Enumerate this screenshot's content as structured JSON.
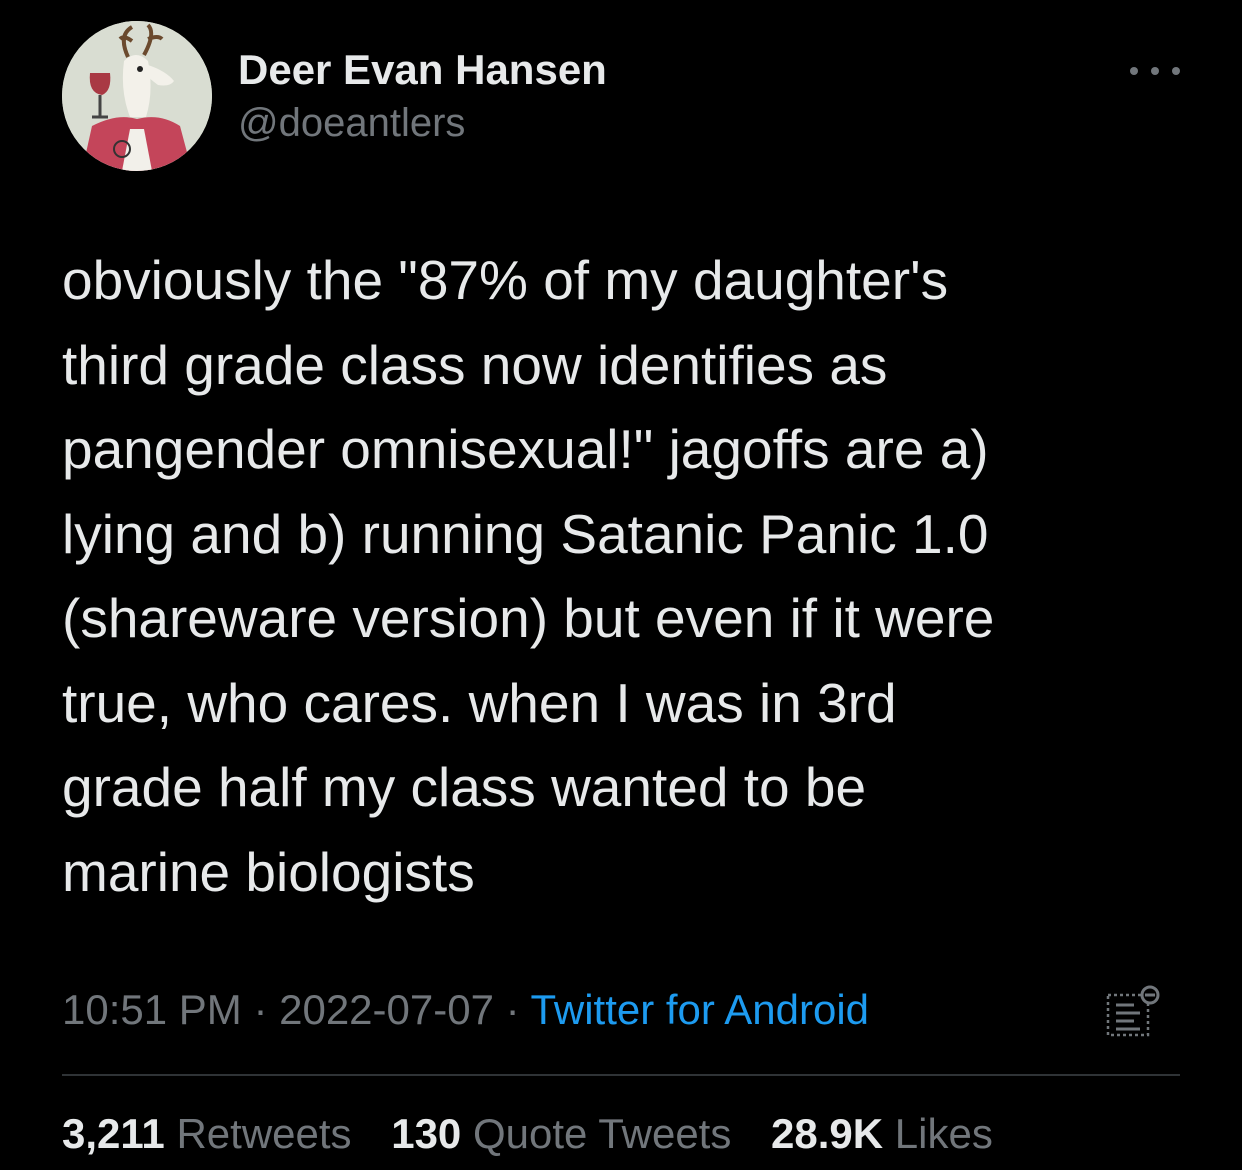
{
  "author": {
    "display_name": "Deer Evan Hansen",
    "handle": "@doeantlers",
    "avatar_icon": "deer-drinking-wine-avatar"
  },
  "more_icon": "ellipsis-icon",
  "tweet": {
    "lines": [
      "obviously the \"87% of my daughter's",
      "third grade class now identifies as",
      "pangender omnisexual!\" jagoffs are a)",
      "lying and b) running Satanic Panic 1.0",
      "(shareware version) but even if it were",
      "true, who cares. when I was in 3rd",
      "grade half my class wanted to be",
      "marine biologists"
    ]
  },
  "meta": {
    "time": "10:51 PM",
    "separator": " · ",
    "date": "2022-07-07",
    "source": "Twitter for Android",
    "analytics_icon": "tweet-analytics-icon"
  },
  "stats": {
    "retweets_count": "3,211",
    "retweets_label": "Retweets",
    "quotes_count": "130",
    "quotes_label": "Quote Tweets",
    "likes_count": "28.9K",
    "likes_label": "Likes"
  },
  "colors": {
    "background": "#000000",
    "text_primary": "#e7e9ea",
    "text_secondary": "#71767b",
    "link": "#1d9bf0",
    "divider": "#2f3336"
  }
}
